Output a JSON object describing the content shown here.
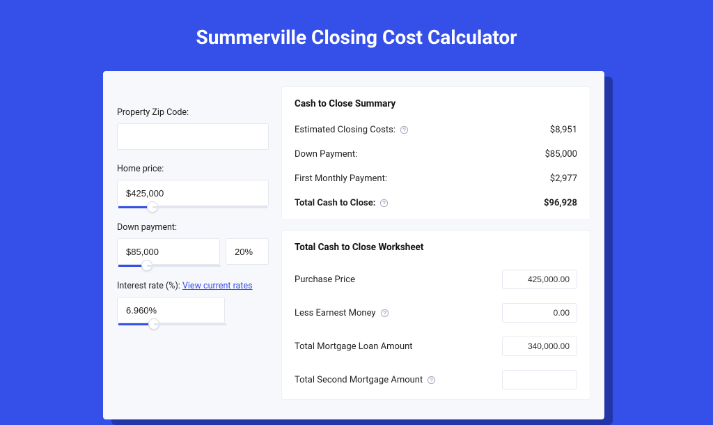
{
  "header": {
    "title": "Summerville Closing Cost Calculator"
  },
  "left": {
    "zip_label": "Property Zip Code:",
    "zip_value": "",
    "home_price_label": "Home price:",
    "home_price_value": "$425,000",
    "down_payment_label": "Down payment:",
    "down_payment_value": "$85,000",
    "down_payment_pct": "20%",
    "interest_label_prefix": "Interest rate (%): ",
    "interest_link": "View current rates",
    "interest_value": "6.960%"
  },
  "summary": {
    "title": "Cash to Close Summary",
    "rows": [
      {
        "label": "Estimated Closing Costs:",
        "help": true,
        "value": "$8,951",
        "bold": false
      },
      {
        "label": "Down Payment:",
        "help": false,
        "value": "$85,000",
        "bold": false
      },
      {
        "label": "First Monthly Payment:",
        "help": false,
        "value": "$2,977",
        "bold": false
      },
      {
        "label": "Total Cash to Close:",
        "help": true,
        "value": "$96,928",
        "bold": true
      }
    ]
  },
  "worksheet": {
    "title": "Total Cash to Close Worksheet",
    "rows": [
      {
        "label": "Purchase Price",
        "help": false,
        "value": "425,000.00"
      },
      {
        "label": "Less Earnest Money",
        "help": true,
        "value": "0.00"
      },
      {
        "label": "Total Mortgage Loan Amount",
        "help": false,
        "value": "340,000.00"
      },
      {
        "label": "Total Second Mortgage Amount",
        "help": true,
        "value": ""
      }
    ]
  }
}
